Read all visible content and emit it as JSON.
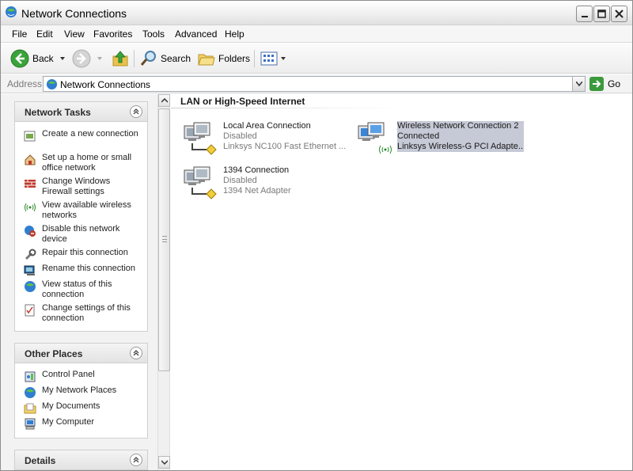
{
  "window": {
    "title": "Network Connections"
  },
  "menubar": {
    "items": [
      "File",
      "Edit",
      "View",
      "Favorites",
      "Tools",
      "Advanced",
      "Help"
    ]
  },
  "toolbar": {
    "back_label": "Back",
    "search_label": "Search",
    "folders_label": "Folders"
  },
  "address": {
    "label": "Address",
    "value": "Network Connections",
    "go_label": "Go"
  },
  "network_tasks": {
    "title": "Network Tasks",
    "items": [
      {
        "label": "Create a new connection",
        "icon": "new-connection-icon"
      },
      {
        "label": "Set up a home or small office network",
        "icon": "home-network-icon"
      },
      {
        "label": "Change Windows Firewall settings",
        "icon": "firewall-icon"
      },
      {
        "label": "View available wireless networks",
        "icon": "wireless-icon"
      },
      {
        "label": "Disable this network device",
        "icon": "disable-icon"
      },
      {
        "label": "Repair this connection",
        "icon": "repair-icon"
      },
      {
        "label": "Rename this connection",
        "icon": "rename-icon"
      },
      {
        "label": "View status of this connection",
        "icon": "status-icon"
      },
      {
        "label": "Change settings of this connection",
        "icon": "settings-icon"
      }
    ]
  },
  "other_places": {
    "title": "Other Places",
    "items": [
      {
        "label": "Control Panel",
        "icon": "control-panel-icon"
      },
      {
        "label": "My Network Places",
        "icon": "network-places-icon"
      },
      {
        "label": "My Documents",
        "icon": "documents-icon"
      },
      {
        "label": "My Computer",
        "icon": "computer-icon"
      }
    ]
  },
  "details": {
    "title": "Details"
  },
  "content": {
    "group_title": "LAN or High-Speed Internet",
    "connections": [
      {
        "name": "Local Area Connection",
        "status": "Disabled",
        "device": "Linksys NC100 Fast Ethernet ...",
        "selected": false
      },
      {
        "name": "Wireless Network Connection 2",
        "status": "Connected",
        "device": "Linksys Wireless-G PCI Adapte...",
        "selected": true
      },
      {
        "name": "1394 Connection",
        "status": "Disabled",
        "device": "1394 Net Adapter",
        "selected": false
      }
    ]
  },
  "colors": {
    "selection": "#c6c9d6",
    "panel_bg": "#f2f2f2",
    "go_green": "#3c9a3c"
  }
}
